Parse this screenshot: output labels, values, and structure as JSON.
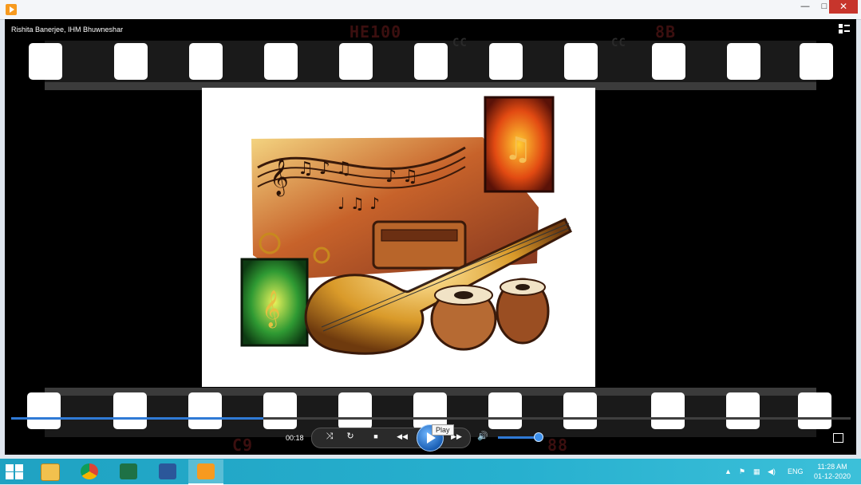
{
  "window": {
    "title_icon": "media-player-icon",
    "controls": {
      "minimize": "—",
      "maximize": "□",
      "close": "✕"
    }
  },
  "player": {
    "video_title": "Rishita Banerjee, IHM Bhuwneshar",
    "film_codes": {
      "top_left": "HE100",
      "top_cc1": "CC",
      "top_cc2": "CC",
      "top_right": "8B",
      "bottom_left": "C9",
      "bottom_right": "88"
    },
    "time": "00:18",
    "progress": 0.3,
    "volume": 0.85,
    "tooltip": "Play",
    "controls": {
      "shuffle": "⤨",
      "repeat": "↻",
      "stop": "■",
      "prev": "◀◀",
      "next": "▶▶",
      "volume": "🔊"
    }
  },
  "taskbar": {
    "language": "ENG",
    "time": "11:28 AM",
    "date": "01-12-2020"
  }
}
